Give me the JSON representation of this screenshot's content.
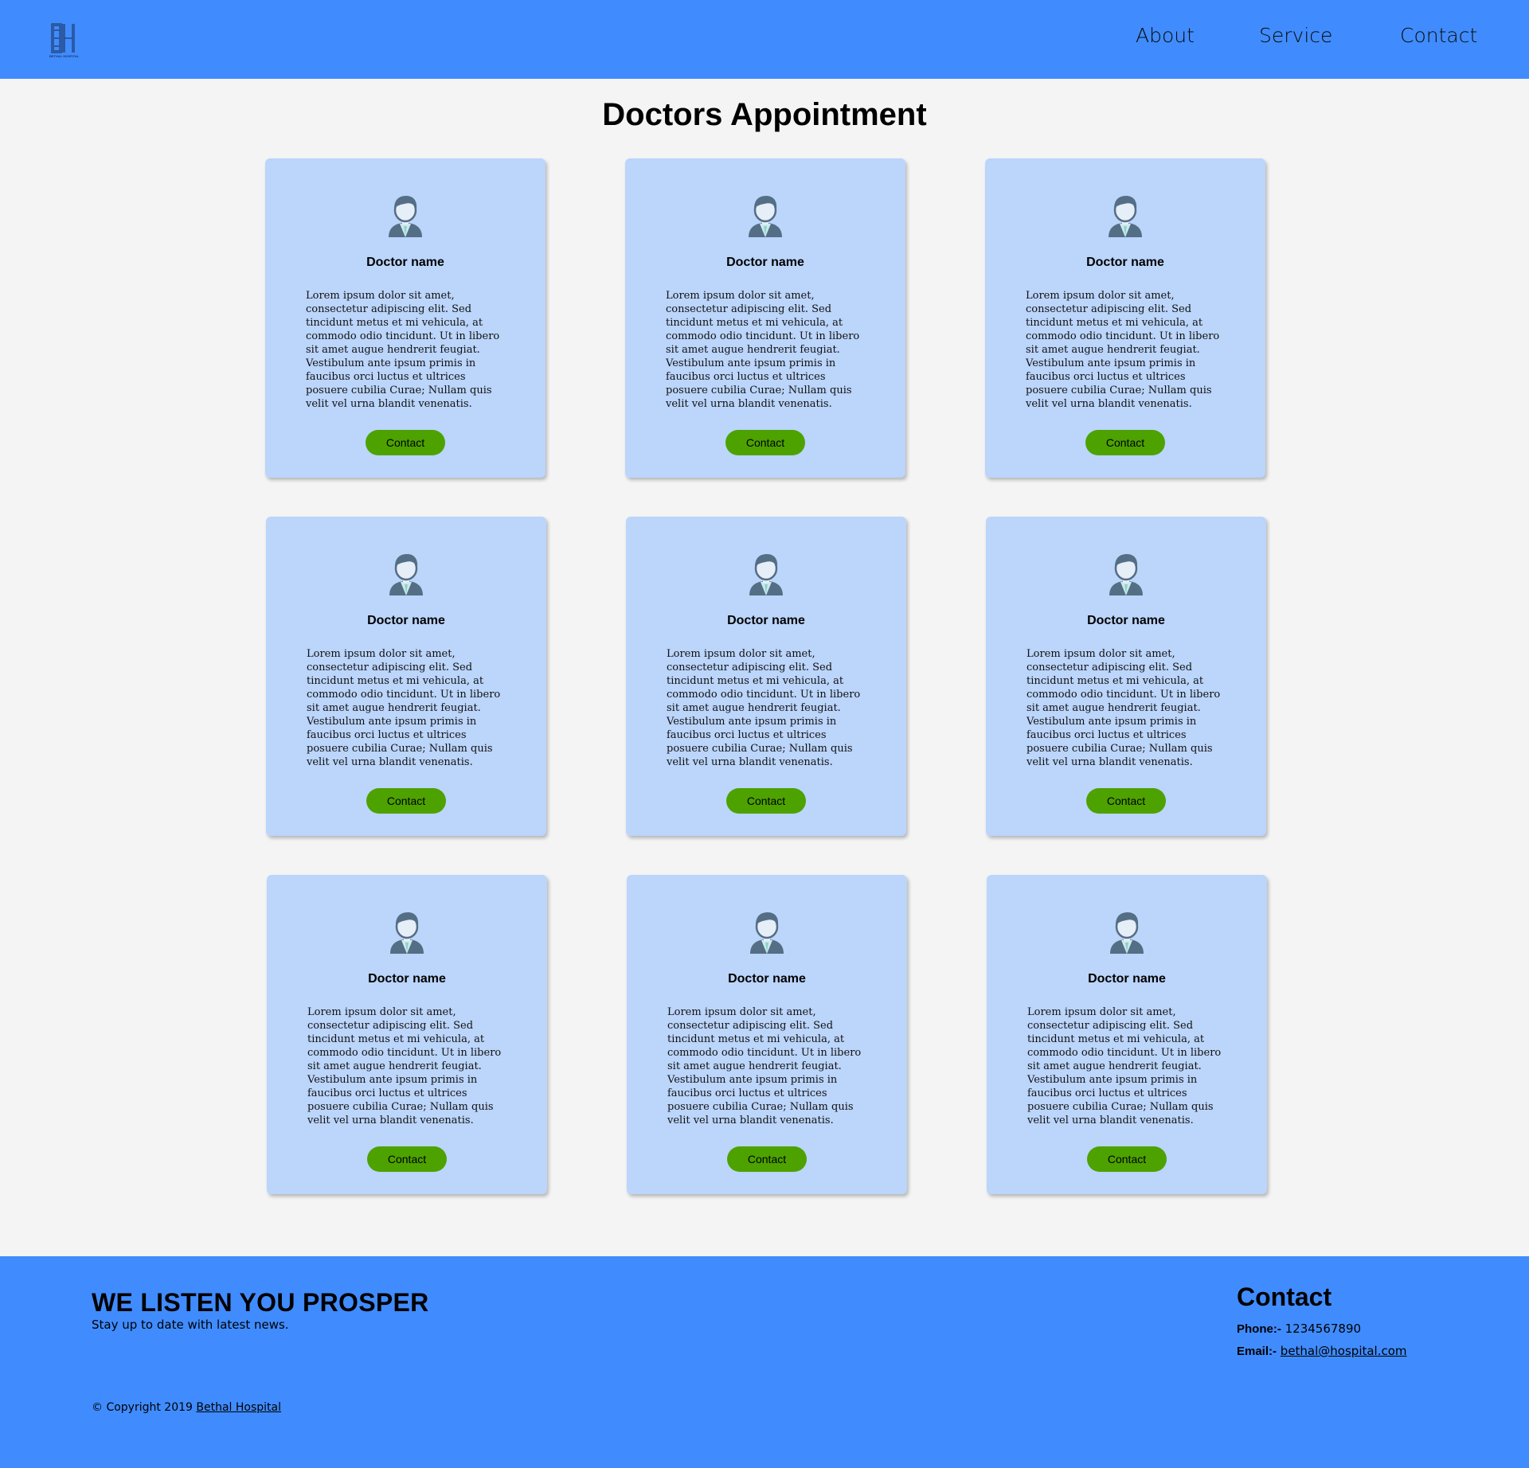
{
  "header": {
    "logo_text": "BETHAL HOSPITAL",
    "nav": [
      {
        "label": "About"
      },
      {
        "label": "Service"
      },
      {
        "label": "Contact"
      }
    ],
    "bg_color": "#408cff"
  },
  "page_title": "Doctors Appointment",
  "doctors": [
    {
      "name": "Doctor name",
      "description": "Lorem ipsum dolor sit amet, consectetur adipiscing elit. Sed tincidunt metus et mi vehicula, at commodo odio tincidunt. Ut in libero sit amet augue hendrerit feugiat. Vestibulum ante ipsum primis in faucibus orci luctus et ultrices posuere cubilia Curae; Nullam quis velit vel urna blandit venenatis.",
      "button_label": "Contact",
      "icon": "doctor-avatar-icon"
    },
    {
      "name": "Doctor name",
      "description": "Lorem ipsum dolor sit amet, consectetur adipiscing elit. Sed tincidunt metus et mi vehicula, at commodo odio tincidunt. Ut in libero sit amet augue hendrerit feugiat. Vestibulum ante ipsum primis in faucibus orci luctus et ultrices posuere cubilia Curae; Nullam quis velit vel urna blandit venenatis.",
      "button_label": "Contact",
      "icon": "doctor-avatar-icon"
    },
    {
      "name": "Doctor name",
      "description": "Lorem ipsum dolor sit amet, consectetur adipiscing elit. Sed tincidunt metus et mi vehicula, at commodo odio tincidunt. Ut in libero sit amet augue hendrerit feugiat. Vestibulum ante ipsum primis in faucibus orci luctus et ultrices posuere cubilia Curae; Nullam quis velit vel urna blandit venenatis.",
      "button_label": "Contact",
      "icon": "doctor-avatar-icon"
    },
    {
      "name": "Doctor name",
      "description": "Lorem ipsum dolor sit amet, consectetur adipiscing elit. Sed tincidunt metus et mi vehicula, at commodo odio tincidunt. Ut in libero sit amet augue hendrerit feugiat. Vestibulum ante ipsum primis in faucibus orci luctus et ultrices posuere cubilia Curae; Nullam quis velit vel urna blandit venenatis.",
      "button_label": "Contact",
      "icon": "doctor-avatar-icon"
    },
    {
      "name": "Doctor name",
      "description": "Lorem ipsum dolor sit amet, consectetur adipiscing elit. Sed tincidunt metus et mi vehicula, at commodo odio tincidunt. Ut in libero sit amet augue hendrerit feugiat. Vestibulum ante ipsum primis in faucibus orci luctus et ultrices posuere cubilia Curae; Nullam quis velit vel urna blandit venenatis.",
      "button_label": "Contact",
      "icon": "doctor-avatar-icon"
    },
    {
      "name": "Doctor name",
      "description": "Lorem ipsum dolor sit amet, consectetur adipiscing elit. Sed tincidunt metus et mi vehicula, at commodo odio tincidunt. Ut in libero sit amet augue hendrerit feugiat. Vestibulum ante ipsum primis in faucibus orci luctus et ultrices posuere cubilia Curae; Nullam quis velit vel urna blandit venenatis.",
      "button_label": "Contact",
      "icon": "doctor-avatar-icon"
    },
    {
      "name": "Doctor name",
      "description": "Lorem ipsum dolor sit amet, consectetur adipiscing elit. Sed tincidunt metus et mi vehicula, at commodo odio tincidunt. Ut in libero sit amet augue hendrerit feugiat. Vestibulum ante ipsum primis in faucibus orci luctus et ultrices posuere cubilia Curae; Nullam quis velit vel urna blandit venenatis.",
      "button_label": "Contact",
      "icon": "doctor-avatar-icon"
    },
    {
      "name": "Doctor name",
      "description": "Lorem ipsum dolor sit amet, consectetur adipiscing elit. Sed tincidunt metus et mi vehicula, at commodo odio tincidunt. Ut in libero sit amet augue hendrerit feugiat. Vestibulum ante ipsum primis in faucibus orci luctus et ultrices posuere cubilia Curae; Nullam quis velit vel urna blandit venenatis.",
      "button_label": "Contact",
      "icon": "doctor-avatar-icon"
    },
    {
      "name": "Doctor name",
      "description": "Lorem ipsum dolor sit amet, consectetur adipiscing elit. Sed tincidunt metus et mi vehicula, at commodo odio tincidunt. Ut in libero sit amet augue hendrerit feugiat. Vestibulum ante ipsum primis in faucibus orci luctus et ultrices posuere cubilia Curae; Nullam quis velit vel urna blandit venenatis.",
      "button_label": "Contact",
      "icon": "doctor-avatar-icon"
    }
  ],
  "footer": {
    "slogan": "WE LISTEN YOU PROSPER",
    "subtext": "Stay up to date with latest news.",
    "copyright_prefix": "© Copyright 2019",
    "copyright_link": "Bethal Hospital",
    "contact_heading": "Contact",
    "phone_label": "Phone:-",
    "phone_value": "1234567890",
    "email_label": "Email:-",
    "email_value": "bethal@hospital.com"
  },
  "colors": {
    "brand_blue": "#408cff",
    "card_bg": "#bbd5fb",
    "button_green": "#4da200",
    "page_bg": "#f4f4f4"
  }
}
